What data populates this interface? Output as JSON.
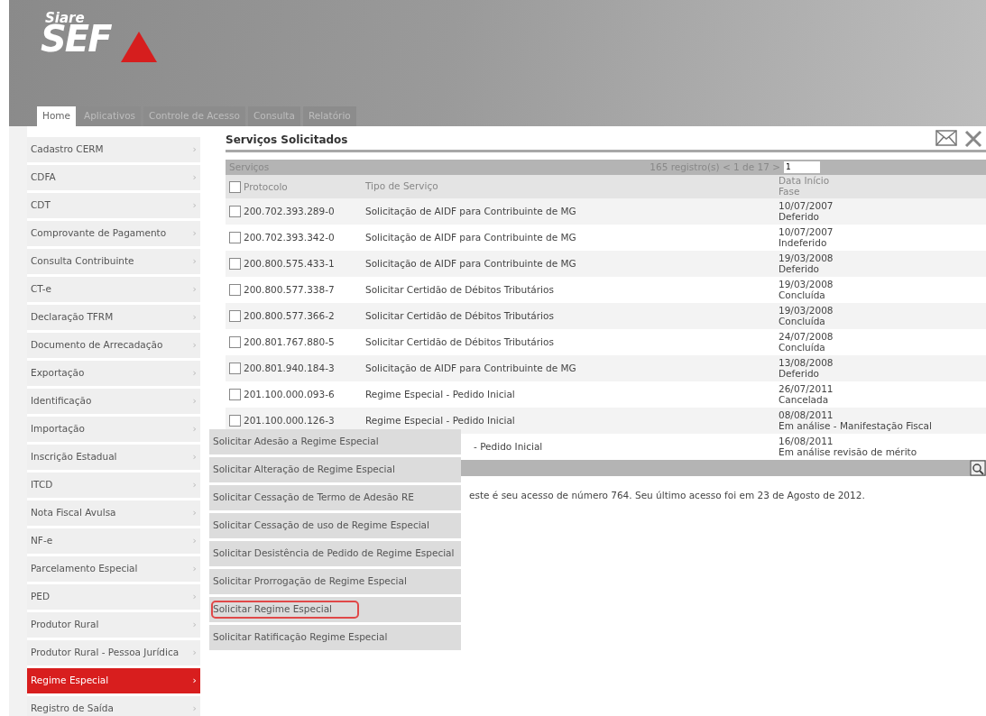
{
  "logo": {
    "small": "Siare",
    "big": "SEF"
  },
  "tabs": [
    {
      "label": "Home",
      "selected": true
    },
    {
      "label": "Aplicativos",
      "selected": false
    },
    {
      "label": "Controle de Acesso",
      "selected": false
    },
    {
      "label": "Consulta",
      "selected": false
    },
    {
      "label": "Relatório",
      "selected": false
    }
  ],
  "sidebar": {
    "items": [
      {
        "label": "Cadastro CERM",
        "selected": false
      },
      {
        "label": "CDFA",
        "selected": false
      },
      {
        "label": "CDT",
        "selected": false
      },
      {
        "label": "Comprovante de Pagamento",
        "selected": false
      },
      {
        "label": "Consulta Contribuinte",
        "selected": false
      },
      {
        "label": "CT-e",
        "selected": false
      },
      {
        "label": "Declaração TFRM",
        "selected": false
      },
      {
        "label": "Documento de Arrecadação",
        "selected": false
      },
      {
        "label": "Exportação",
        "selected": false
      },
      {
        "label": "Identificação",
        "selected": false
      },
      {
        "label": "Importação",
        "selected": false
      },
      {
        "label": "Inscrição Estadual",
        "selected": false
      },
      {
        "label": "ITCD",
        "selected": false
      },
      {
        "label": "Nota Fiscal Avulsa",
        "selected": false
      },
      {
        "label": "NF-e",
        "selected": false
      },
      {
        "label": "Parcelamento Especial",
        "selected": false
      },
      {
        "label": "PED",
        "selected": false
      },
      {
        "label": "Produtor Rural",
        "selected": false
      },
      {
        "label": "Produtor Rural - Pessoa Jurídica",
        "selected": false
      },
      {
        "label": "Regime Especial",
        "selected": true
      },
      {
        "label": "Registro de Saída",
        "selected": false
      }
    ],
    "arrow": "›"
  },
  "submenu": {
    "items": [
      {
        "label": "Solicitar Adesão a Regime Especial",
        "highlighted": false
      },
      {
        "label": "Solicitar Alteração de Regime Especial",
        "highlighted": false
      },
      {
        "label": "Solicitar Cessação de Termo de Adesão RE",
        "highlighted": false
      },
      {
        "label": "Solicitar Cessação de uso de Regime Especial",
        "highlighted": false
      },
      {
        "label": "Solicitar Desistência de Pedido de Regime Especial",
        "highlighted": false
      },
      {
        "label": "Solicitar Prorrogação de Regime Especial",
        "highlighted": false
      },
      {
        "label": "Solicitar Regime Especial",
        "highlighted": true
      },
      {
        "label": "Solicitar Ratificação Regime Especial",
        "highlighted": false
      }
    ]
  },
  "panel": {
    "title": "Serviços Solicitados"
  },
  "table": {
    "caption": "Serviços",
    "all_checked": false,
    "pagination": "165 registro(s) < 1 de 17 >",
    "page_input": "1",
    "columns": [
      "Protocolo",
      "Tipo de Serviço",
      "Data Início",
      "Fase"
    ],
    "rows": [
      {
        "protocol": "200.702.393.289-0",
        "type": "Solicitação de AIDF para Contribuinte de MG",
        "date": "10/07/2007",
        "phase": "Deferido",
        "checked": false
      },
      {
        "protocol": "200.702.393.342-0",
        "type": "Solicitação de AIDF para Contribuinte de MG",
        "date": "10/07/2007",
        "phase": "Indeferido",
        "checked": false
      },
      {
        "protocol": "200.800.575.433-1",
        "type": "Solicitação de AIDF para Contribuinte de MG",
        "date": "19/03/2008",
        "phase": "Deferido",
        "checked": false
      },
      {
        "protocol": "200.800.577.338-7",
        "type": "Solicitar Certidão de Débitos Tributários",
        "date": "19/03/2008",
        "phase": "Concluída",
        "checked": false
      },
      {
        "protocol": "200.800.577.366-2",
        "type": "Solicitar Certidão de Débitos Tributários",
        "date": "19/03/2008",
        "phase": "Concluída",
        "checked": false
      },
      {
        "protocol": "200.801.767.880-5",
        "type": "Solicitar Certidão de Débitos Tributários",
        "date": "24/07/2008",
        "phase": "Concluída",
        "checked": false
      },
      {
        "protocol": "200.801.940.184-3",
        "type": "Solicitação de AIDF para Contribuinte de MG",
        "date": "13/08/2008",
        "phase": "Deferido",
        "checked": false
      },
      {
        "protocol": "201.100.000.093-6",
        "type": "Regime Especial - Pedido Inicial",
        "date": "26/07/2011",
        "phase": "Cancelada",
        "checked": false
      },
      {
        "protocol": "201.100.000.126-3",
        "type": "Regime Especial - Pedido Inicial",
        "date": "08/08/2011",
        "phase": "Em análise - Manifestação Fiscal",
        "checked": false
      },
      {
        "type": "- Pedido Inicial",
        "date": "16/08/2011",
        "phase": "Em análise revisão de mérito"
      }
    ]
  },
  "message": "este é seu acesso de número 764. Seu último acesso foi em 23 de Agosto de 2012."
}
